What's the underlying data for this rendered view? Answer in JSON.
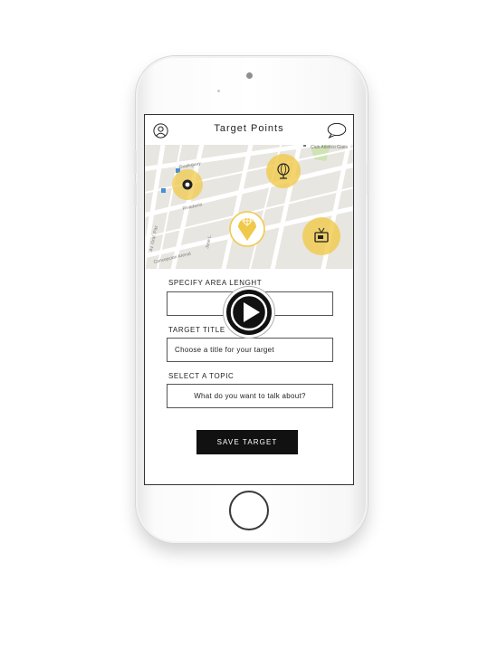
{
  "header": {
    "title": "Target Points",
    "profile_icon": "user-circle-icon",
    "chat_icon": "speech-bubble-icon"
  },
  "map": {
    "place_label": "Club Atletico Gaes",
    "street_labels": [
      "Gualeguay",
      "Rivadavia",
      "Av. Gral. Paz",
      "Concepcion Arenal",
      "Jose L."
    ],
    "markers": [
      {
        "name": "soccer-ball-icon"
      },
      {
        "name": "globe-icon"
      },
      {
        "name": "tv-icon"
      },
      {
        "name": "location-crosshair-icon"
      }
    ],
    "accent_color": "#f0c94a"
  },
  "form": {
    "area_label": "SPECIFY AREA LENGHT",
    "area_value": "",
    "title_label": "TARGET TITLE",
    "title_placeholder": "Choose a title for your target",
    "topic_label": "SELECT A TOPIC",
    "topic_placeholder": "What do you want to talk about?",
    "save_label": "SAVE TARGET"
  },
  "video": {
    "play_icon": "play-icon"
  }
}
